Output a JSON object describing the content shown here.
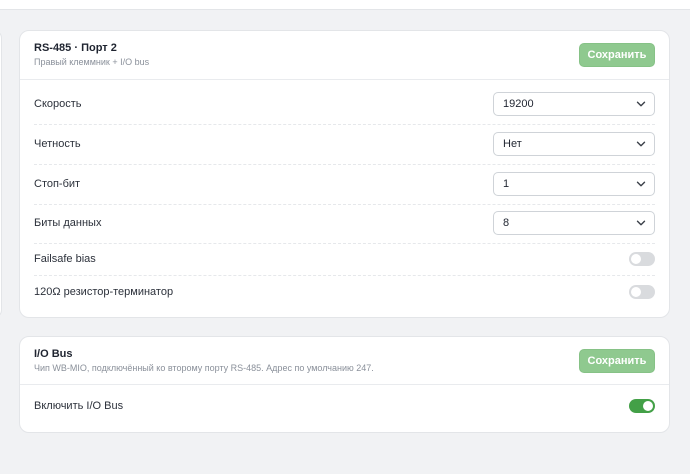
{
  "port2": {
    "title": "RS-485 · Порт 2",
    "subtitle": "Правый клеммник + I/O bus",
    "save_label": "Сохранить",
    "speed": {
      "label": "Скорость",
      "value": "19200"
    },
    "parity": {
      "label": "Четность",
      "value": "Нет"
    },
    "stop_bits": {
      "label": "Стоп-бит",
      "value": "1"
    },
    "data_bits": {
      "label": "Биты данных",
      "value": "8"
    },
    "failsafe": {
      "label": "Failsafe bias",
      "enabled": false
    },
    "terminator": {
      "label": "120Ω резистор-терминатор",
      "enabled": false
    }
  },
  "iobus": {
    "title": "I/O Bus",
    "subtitle": "Чип WB-MIO, подключённый ко второму порту RS-485. Адрес по умолчанию 247.",
    "save_label": "Сохранить",
    "enable": {
      "label": "Включить I/O Bus",
      "enabled": true
    }
  },
  "colors": {
    "save_button": "#8fc98f",
    "toggle_on": "#43a047",
    "toggle_off": "#d9dbde"
  },
  "icons": {
    "select_arrow": "chevron-down-icon"
  }
}
